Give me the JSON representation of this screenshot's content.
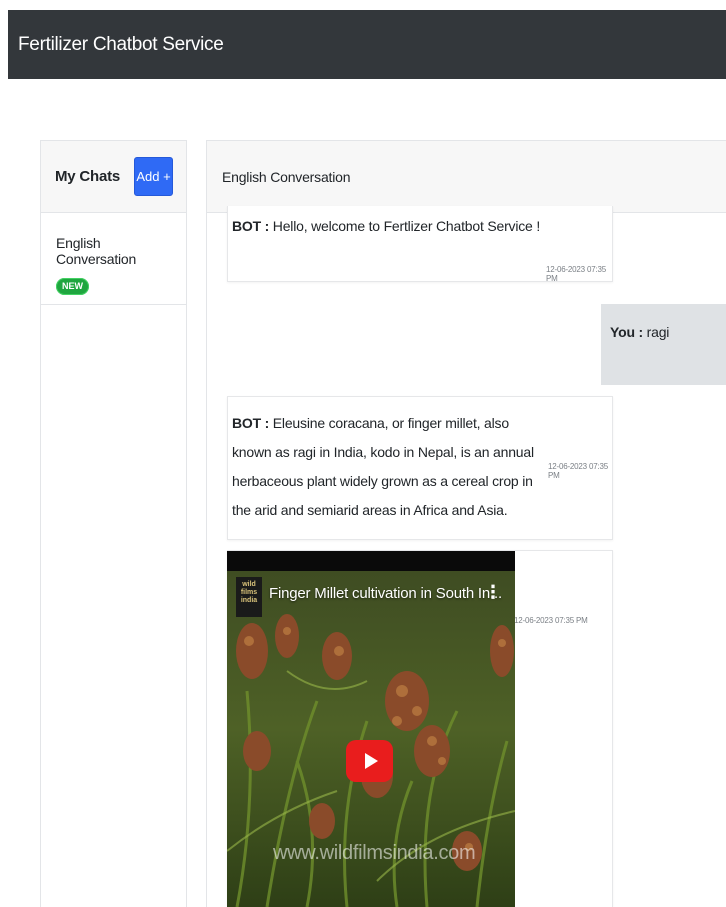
{
  "app": {
    "title": "Fertilizer Chatbot Service"
  },
  "sidebar": {
    "title": "My Chats",
    "add_label": "Add +",
    "items": [
      {
        "label": "English Conversation",
        "badge": "NEW"
      }
    ]
  },
  "conversation": {
    "title": "English Conversation",
    "messages": [
      {
        "speaker": "BOT :",
        "text": " Hello, welcome to Fertlizer Chatbot Service !",
        "time": "12-06-2023 07:35 PM"
      },
      {
        "speaker": "You :",
        "text": " ragi"
      },
      {
        "speaker": "BOT :",
        "text": " Eleusine coracana, or finger millet, also known as ragi in India, kodo in Nepal, is an annual herbaceous plant widely grown as a cereal crop in the arid and semiarid areas in Africa and Asia.",
        "time": "12-06-2023 07:35 PM"
      },
      {
        "time": "12-06-2023 07:35 PM"
      }
    ],
    "video": {
      "title": "Finger Millet cultivation in South In...",
      "channel": "wild films india",
      "watermark": "www.wildfilmsindia.com"
    }
  },
  "colors": {
    "topbar": "#33373b",
    "add_button": "#2f6af5",
    "badge_new": "#1fa63f",
    "user_bubble": "#dfe2e5",
    "play_button": "#e91d1d"
  },
  "icons": [
    "play-icon",
    "more-vert-icon",
    "channel-logo"
  ]
}
